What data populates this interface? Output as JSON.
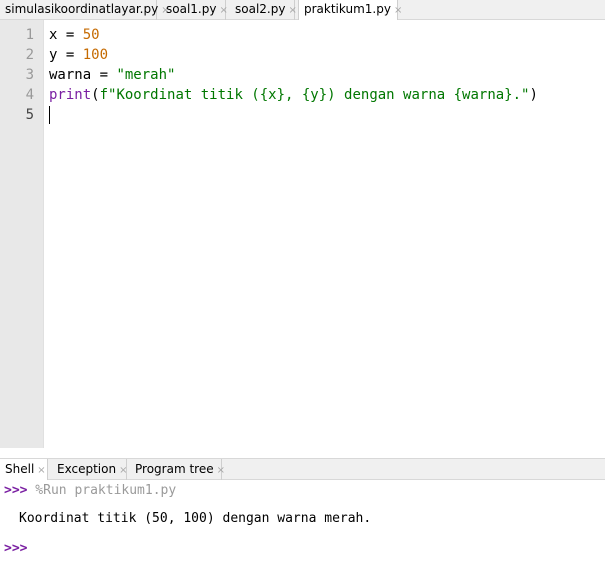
{
  "editor_tabs": [
    {
      "label": "simulasikoordinatlayar.py",
      "close": "×"
    },
    {
      "label": "soal1.py",
      "close": "×"
    },
    {
      "label": "soal2.py",
      "close": "×"
    },
    {
      "label": "praktikum1.py",
      "close": "×"
    }
  ],
  "line_numbers": [
    "1",
    "2",
    "3",
    "4",
    "5"
  ],
  "code": {
    "l1_var": "x = ",
    "l1_val": "50",
    "l2_var": "y = ",
    "l2_val": "100",
    "l3_var": "warna = ",
    "l3_val": "\"merah\"",
    "l4_fn": "print",
    "l4_open": "(",
    "l4_str": "f\"Koordinat titik ({x}, {y}) dengan warna {warna}.\"",
    "l4_close": ")"
  },
  "shell_tabs": [
    {
      "label": "Shell",
      "close": "×"
    },
    {
      "label": "Exception",
      "close": "×"
    },
    {
      "label": "Program tree",
      "close": "×"
    }
  ],
  "shell": {
    "prompt": ">>>",
    "command": " %Run praktikum1.py",
    "output": "Koordinat titik (50, 100) dengan warna merah.",
    "prompt2": ">>>"
  },
  "colors": {
    "number": "#c56a00",
    "string": "#007700",
    "keyword": "#7a1fa2"
  }
}
